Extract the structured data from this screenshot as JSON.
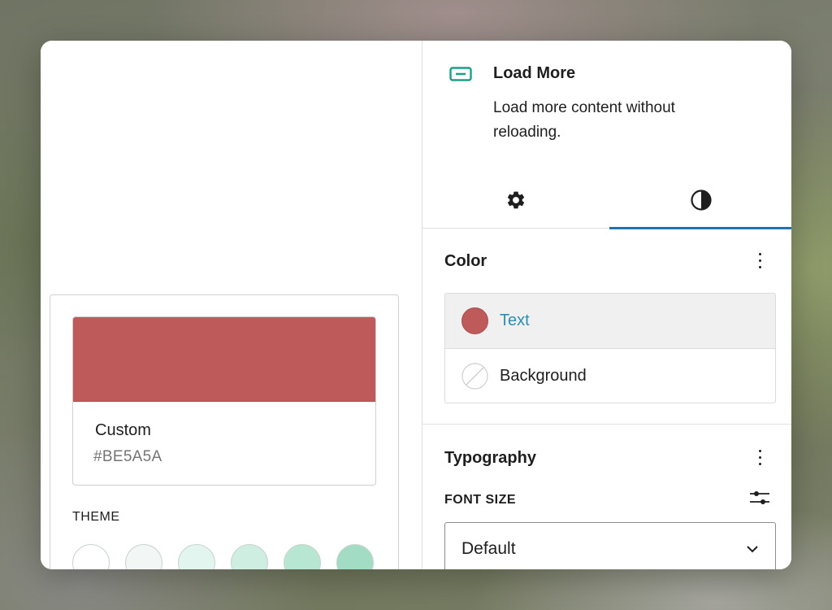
{
  "popover": {
    "swatch_name": "Custom",
    "swatch_hex": "#BE5A5A",
    "swatch_color": "#BE5A5A",
    "theme_label": "THEME",
    "theme_colors": [
      "#ffffff",
      "#f2f7f6",
      "#e3f5ef",
      "#cfeee2",
      "#b7e6d3",
      "#a3dcc4"
    ]
  },
  "block": {
    "icon": "button-block-icon",
    "title": "Load More",
    "description": "Load more content without reloading."
  },
  "tabs": [
    {
      "icon": "gear-icon",
      "label": "Settings"
    },
    {
      "icon": "half-circle-icon",
      "label": "Styles",
      "active": true
    }
  ],
  "color_panel": {
    "title": "Color",
    "items": [
      {
        "label": "Text",
        "swatch": "#BE5A5A",
        "active": true
      },
      {
        "label": "Background",
        "swatch": "none"
      }
    ]
  },
  "typography_panel": {
    "title": "Typography",
    "font_size_label": "FONT SIZE",
    "font_size_value": "Default"
  },
  "colors": {
    "accent": "#2271b1",
    "link": "#2c8fae",
    "block_icon": "#1aa085"
  }
}
